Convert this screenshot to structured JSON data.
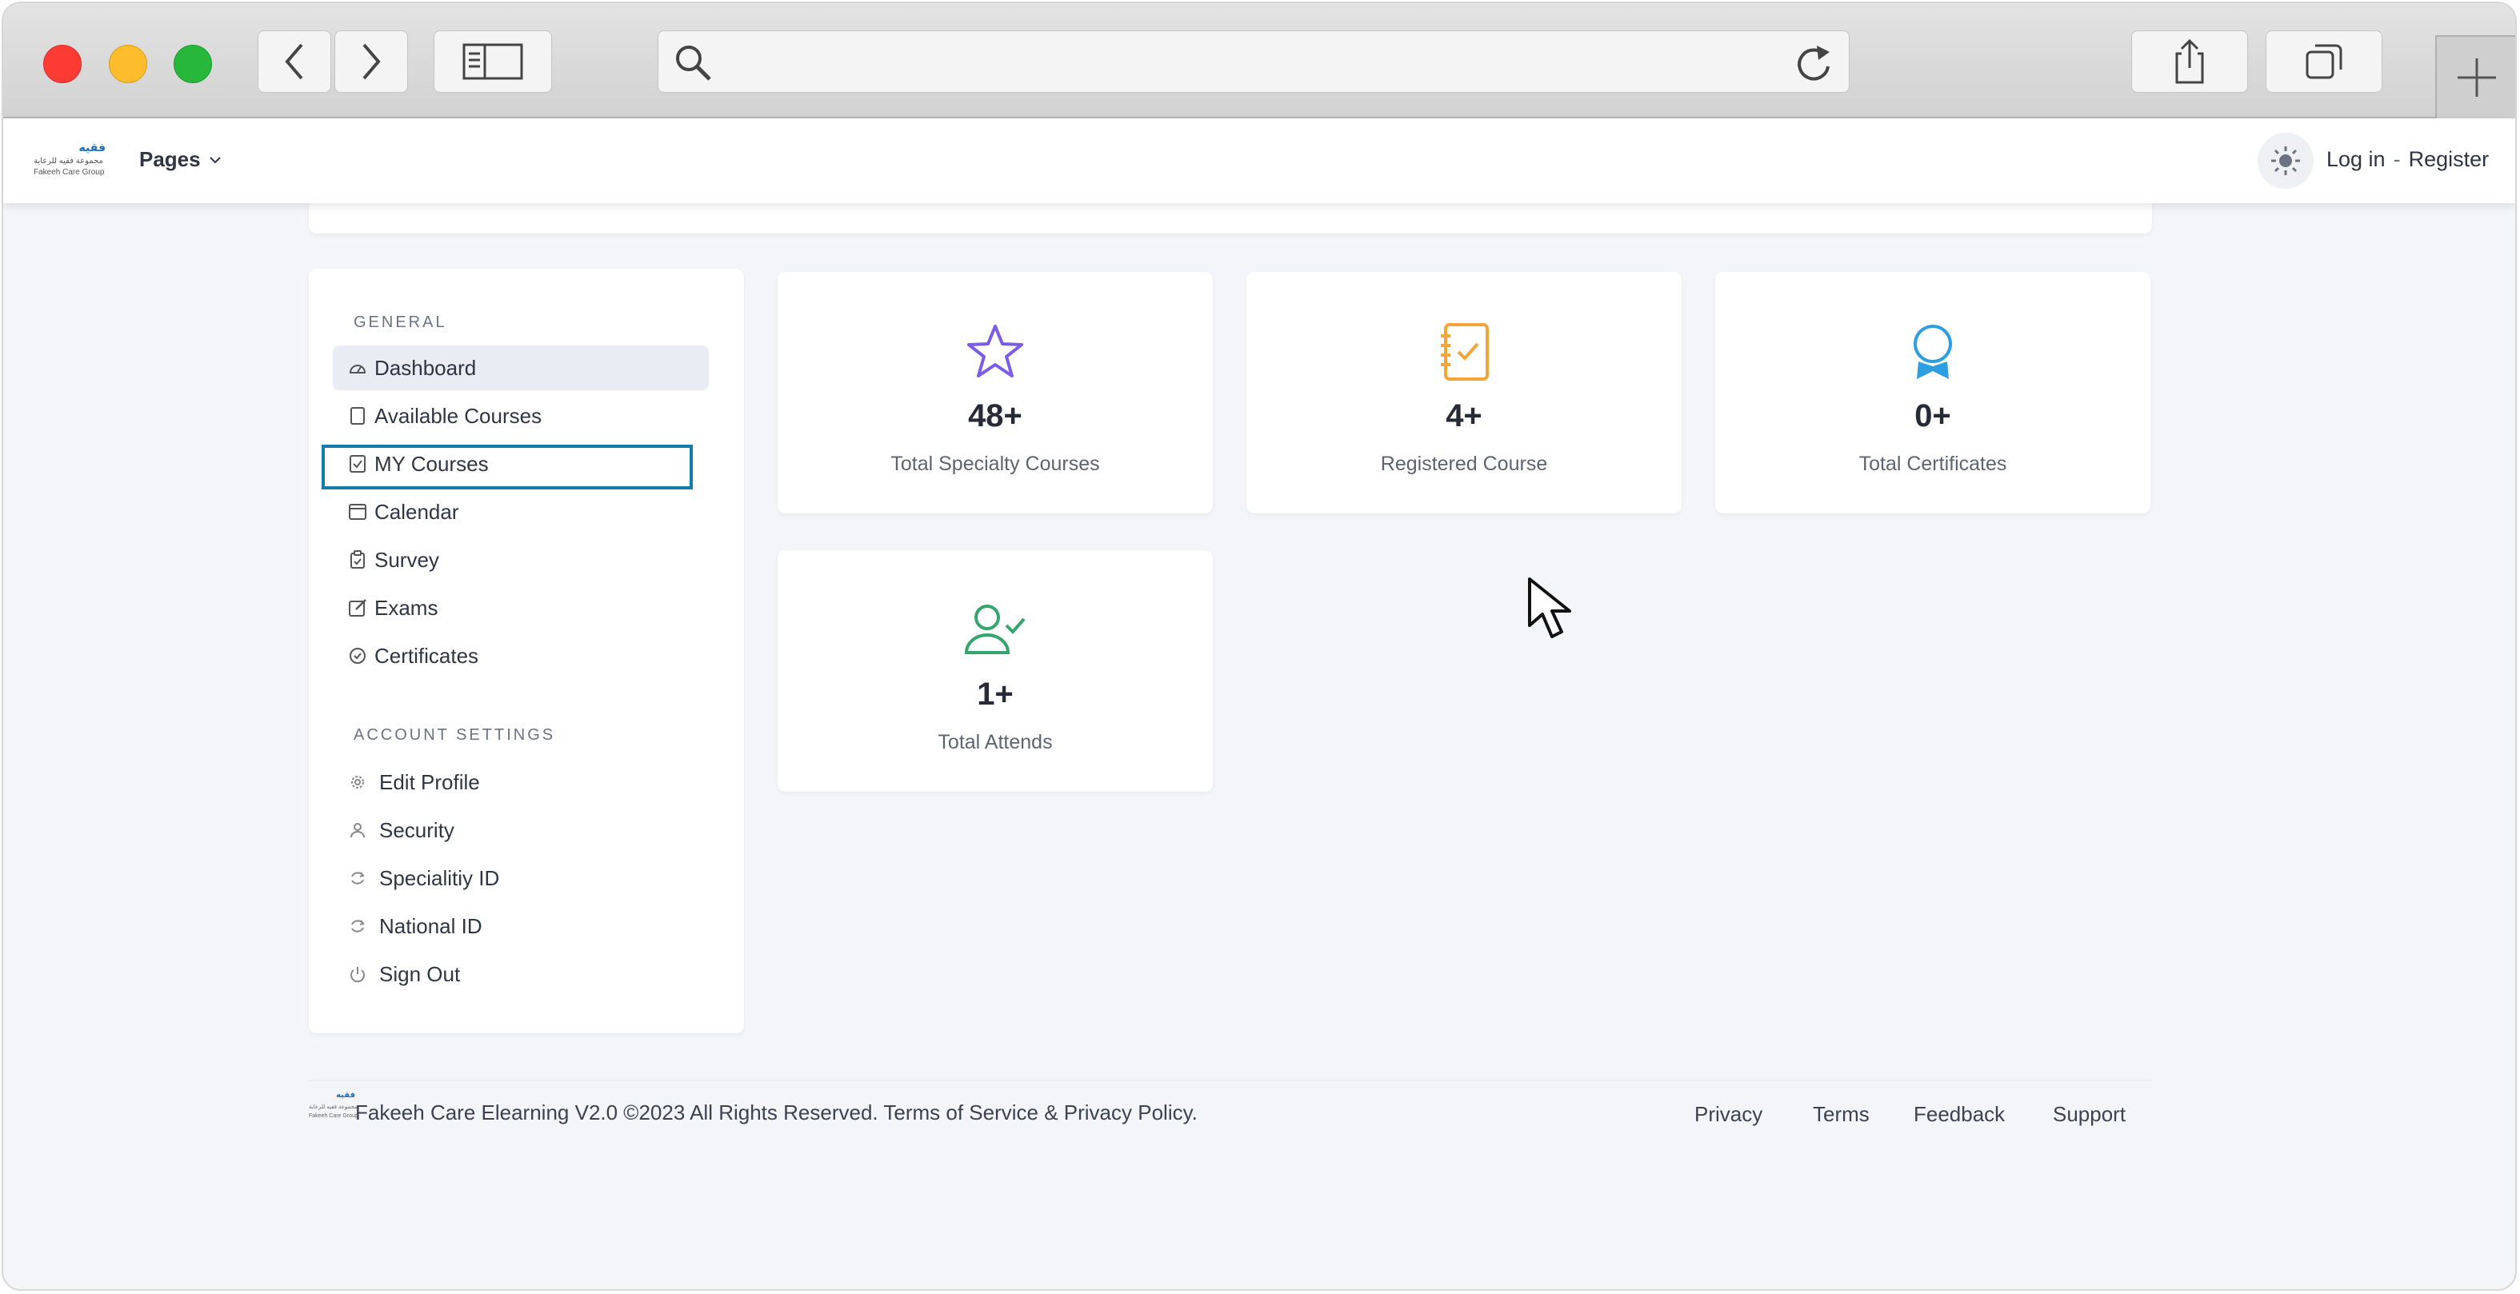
{
  "browser": {
    "url": "",
    "colors": {
      "close": "#fd3b35",
      "minimize": "#fcbc2b",
      "zoom": "#27b73b"
    },
    "icons": [
      "back-arrow-icon",
      "forward-arrow-icon",
      "sidebar-toggle-icon",
      "search-icon",
      "reload-icon",
      "share-icon",
      "tabs-icon",
      "plus-icon"
    ]
  },
  "header": {
    "logo": {
      "arabic": "فقيه",
      "arabic_sub": "مجموعة فقيه للرعاية",
      "english": "Fakeeh Care Group"
    },
    "pages_label": "Pages",
    "login_label": "Log in",
    "separator": "-",
    "register_label": "Register",
    "theme_icon": "sun-icon"
  },
  "sidebar": {
    "general_title": "GENERAL",
    "general_items": [
      {
        "label": "Dashboard",
        "icon": "dashboard-icon",
        "active": true
      },
      {
        "label": "Available Courses",
        "icon": "file-icon"
      },
      {
        "label": "MY Courses",
        "icon": "checkbox-icon",
        "highlighted": true
      },
      {
        "label": "Calendar",
        "icon": "calendar-icon"
      },
      {
        "label": "Survey",
        "icon": "clipboard-icon"
      },
      {
        "label": "Exams",
        "icon": "edit-icon"
      },
      {
        "label": "Certificates",
        "icon": "check-circle-icon"
      }
    ],
    "account_title": "ACCOUNT SETTINGS",
    "account_items": [
      {
        "label": "Edit Profile",
        "icon": "gear-icon"
      },
      {
        "label": "Security",
        "icon": "user-icon"
      },
      {
        "label": "Specialitiy ID",
        "icon": "refresh-icon"
      },
      {
        "label": "National ID",
        "icon": "refresh-icon"
      },
      {
        "label": "Sign Out",
        "icon": "power-icon"
      }
    ]
  },
  "stats": [
    {
      "value": "48+",
      "label": "Total Specialty Courses",
      "icon": "star-icon",
      "color": "#7b5ce6"
    },
    {
      "value": "4+",
      "label": "Registered Course",
      "icon": "notebook-check-icon",
      "color": "#f4a53a"
    },
    {
      "value": "0+",
      "label": "Total Certificates",
      "icon": "award-icon",
      "color": "#2d9ee0"
    },
    {
      "value": "1+",
      "label": "Total Attends",
      "icon": "user-check-icon",
      "color": "#34a56f"
    }
  ],
  "footer": {
    "copyright": "Fakeeh Care Elearning V2.0 ©2023 All Rights Reserved. Terms of Service & Privacy Policy.",
    "links": [
      "Privacy",
      "Terms",
      "Feedback",
      "Support"
    ]
  },
  "highlight_color": "#157ca8"
}
